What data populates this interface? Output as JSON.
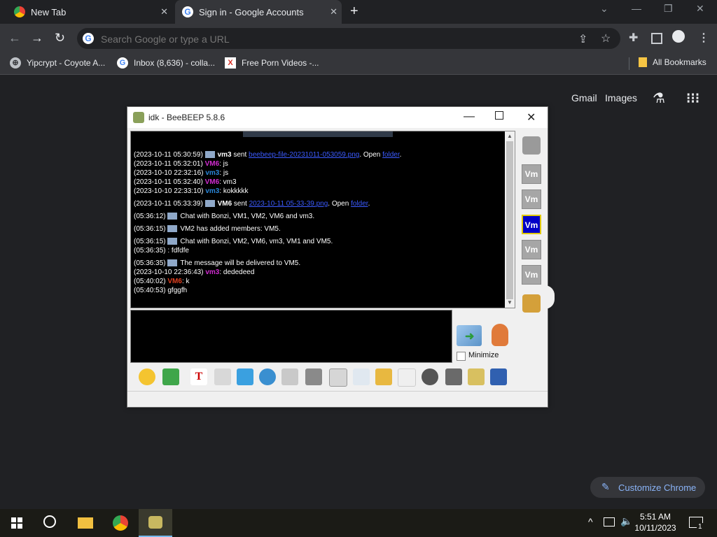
{
  "browser": {
    "tabs": [
      {
        "title": "New Tab",
        "close": "✕"
      },
      {
        "title": "Sign in - Google Accounts",
        "close": "✕"
      }
    ],
    "new_tab": "+",
    "window_controls": {
      "dropdown": "⌄",
      "minimize": "—",
      "restore": "❐",
      "close": "✕"
    },
    "nav": {
      "back": "←",
      "forward": "→",
      "reload": "↻"
    },
    "omnibox_placeholder": "Search Google or type a URL",
    "bookmarks": [
      {
        "label": "Yipcrypt - Coyote A..."
      },
      {
        "label": "Inbox (8,636) - colla..."
      },
      {
        "label": "Free Porn Videos -..."
      }
    ],
    "all_bookmarks": "All Bookmarks"
  },
  "ntp": {
    "gmail": "Gmail",
    "images": "Images",
    "customize": "Customize Chrome"
  },
  "beebeep": {
    "title": "idk - BeeBEEP 5.8.6",
    "messages": [
      {
        "time": "(2023-10-11 05:30:59)",
        "user": "vm3",
        "color": "#ffffff",
        "text": " sent ",
        "link": "beebeep-file-20231011-053059.png",
        "open": ". Open ",
        "folder": "folder",
        "end": ".",
        "icon": true
      },
      {
        "time": "(2023-10-11 05:32:01)",
        "user": "VM6",
        "color": "#d02cd0",
        "text": ": js"
      },
      {
        "time": "(2023-10-10 22:32:16)",
        "user": "vm3",
        "color": "#2a86d8",
        "text": ": js"
      },
      {
        "time": "(2023-10-11 05:32:40)",
        "user": "VM6",
        "color": "#d02cd0",
        "text": ": vm3"
      },
      {
        "time": "(2023-10-10 22:33:10)",
        "user": "vm3",
        "color": "#2a86d8",
        "text": ": kokkkkk"
      },
      {
        "time": "(2023-10-11 05:33:39)",
        "user": "VM6",
        "color": "#ffffff",
        "text": " sent ",
        "link": "2023-10-11 05-33-39.png",
        "open": ". Open ",
        "folder": "folder",
        "end": ".",
        "icon": true
      },
      {
        "time": "(05:36:12)",
        "user": "",
        "color": "#ffffff",
        "text": "Chat with Bonzi, VM1, VM2, VM6 and vm3.",
        "icon": true
      },
      {
        "time": "(05:36:15)",
        "user": "",
        "color": "#ffffff",
        "text": "VM2 has added members: VM5.",
        "icon": true
      },
      {
        "time": "(05:36:15)",
        "user": "",
        "color": "#ffffff",
        "text": "Chat with Bonzi, VM2, VM6, vm3, VM1 and VM5.",
        "icon": true
      },
      {
        "time": "(05:36:35)",
        "user": "",
        "color": "#ffffff",
        "text": "      : fdfdfe"
      },
      {
        "time": "(05:36:35)",
        "user": "",
        "color": "#ffffff",
        "text": "The message will be delivered to VM5.",
        "icon": true
      },
      {
        "time": "(2023-10-10 22:36:43)",
        "user": "vm3",
        "color": "#d02cd0",
        "text": ": dededeed"
      },
      {
        "time": "(05:40:02)",
        "user": "VM6",
        "color": "#e04020",
        "text": ": k"
      },
      {
        "time": "(05:40:53)",
        "user": "",
        "color": "#ffffff",
        "text": "   gfggfh"
      }
    ],
    "minimize_label": "Minimize",
    "vm_labels": [
      "Vm",
      "Vm",
      "Vm",
      "Vm",
      "Vm"
    ],
    "selected_vm": 2
  },
  "taskbar": {
    "time": "5:51 AM",
    "date": "10/11/2023",
    "notification_count": "1"
  }
}
